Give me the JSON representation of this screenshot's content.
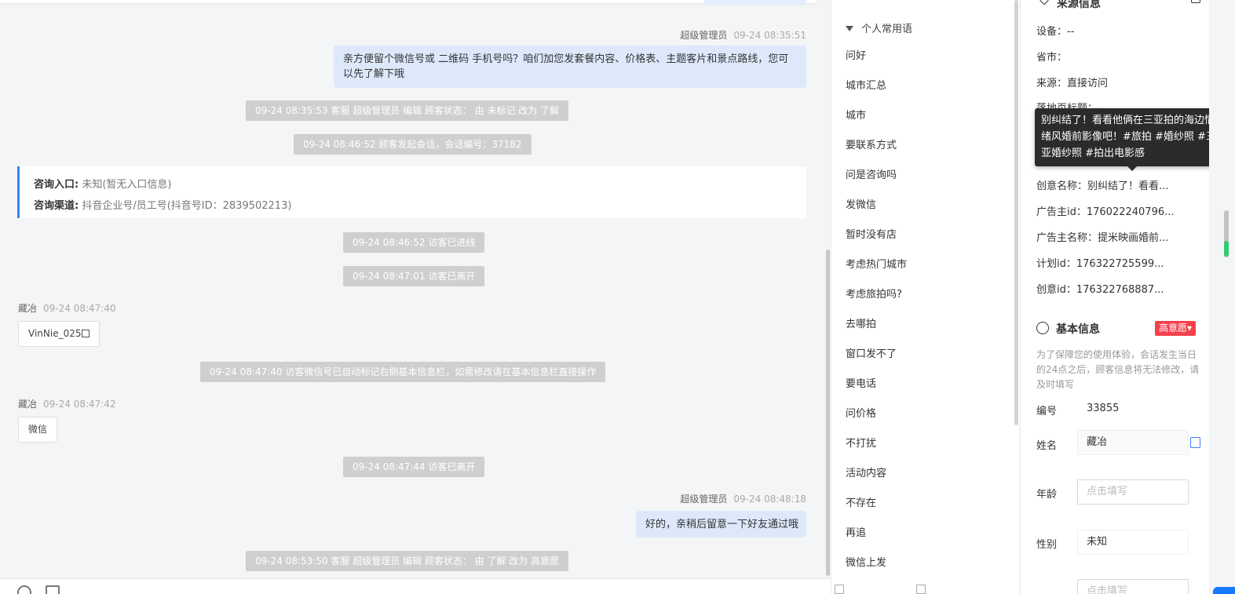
{
  "chat": {
    "msg1_sender": "超级管理员",
    "msg1_time": "09-24 08:35:51",
    "msg1_text": "亲方便留个微信号或 二维码 手机号吗？咱们加您发套餐内容、价格表、主题客片和景点路线，您可以先了解下哦",
    "sys1": "09-24 08:35:53 客服 超级管理员 编辑 顾客状态： 由 未标记 改为 了解",
    "sys2": "09-24 08:46:52 顾客发起会话，会话编号：37182",
    "consult_entry_label": "咨询入口:",
    "consult_entry_value": "未知(暂无入口信息)",
    "consult_channel_label": "咨询渠道:",
    "consult_channel_value": "抖音企业号/员工号(抖音号ID：2839502213)",
    "sys3": "09-24 08:46:52 访客已进线",
    "sys4": "09-24 08:47:01 访客已离开",
    "msg2_sender": "藏冶",
    "msg2_time": "09-24 08:47:40",
    "msg2_text": "VinNie_025",
    "sys5": "09-24 08:47:40 访客微信号已自动标记右侧基本信息栏，如需修改请在基本信息栏直接操作",
    "msg3_sender": "藏冶",
    "msg3_time": "09-24 08:47:42",
    "msg3_text": "微信",
    "sys6": "09-24 08:47:44 访客已离开",
    "msg4_sender": "超级管理员",
    "msg4_time": "09-24 08:48:18",
    "msg4_text": "好的，亲稍后留意一下好友通过哦",
    "sys7": "09-24 08:53:50 客服 超级管理员 编辑 顾客状态： 由 了解 改为 高意愿"
  },
  "phrases": {
    "header": "个人常用语",
    "items": [
      "问好",
      "城市汇总",
      "城市",
      "要联系方式",
      "问是咨询吗",
      "发微信",
      "暂时没有店",
      "考虑热门城市",
      "考虑旅拍吗?",
      "去哪拍",
      "窗口发不了",
      "要电话",
      "问价格",
      "不打扰",
      "活动内容",
      "不存在",
      "再追",
      "微信上发"
    ]
  },
  "source": {
    "title": "来源信息",
    "device": "设备：--",
    "province": "省市：",
    "origin": "来源：直接访问",
    "landing": "落地页标题：--",
    "creative_name": "创意名称：别纠结了！看看...",
    "advertiser_id": "广告主id：176022240796...",
    "advertiser_name": "广告主名称：提米映画婚前...",
    "plan_id": "计划id：176322725599...",
    "creative_id": "创意id：176322768887..."
  },
  "tooltip": "别纠结了！看看他俩在三亚拍的海边情绪风婚前影像吧！#旅拍 #婚纱照 #三亚婚纱照 #拍出电影感",
  "basic": {
    "title": "基本信息",
    "tag": "高意愿",
    "note": "为了保障您的使用体验，会话发生当日的24点之后，顾客信息将无法修改，请及时填写",
    "id_label": "编号",
    "id_value": "33855",
    "name_label": "姓名",
    "name_value": "藏冶",
    "age_label": "年龄",
    "age_placeholder": "点击填写",
    "gender_label": "性别",
    "gender_value": "未知",
    "next_placeholder": "点击填写"
  }
}
